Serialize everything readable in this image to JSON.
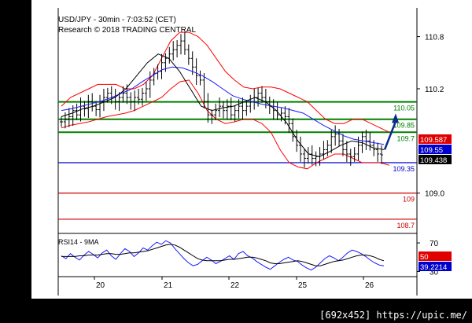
{
  "header": {
    "symbol_line": "USD/JPY - 30min - 7:03:52 (CET)",
    "research_line": "Research © 2018 TRADING CENTRAL"
  },
  "watermark": "[692x452] https://upic.me/",
  "colors": {
    "background": "#ffffff",
    "price_bars": "#000000",
    "bollinger": "#ff0000",
    "ma_slow": "#1a1aff",
    "ma_fast": "#000000",
    "resistance": "#008000",
    "support_blue": "#0000cc",
    "support_red": "#cc0000",
    "arrow": "#0b2a8c",
    "rsi_line": "#1a1aff",
    "rsi_ma": "#000000",
    "label_bg_red": "#e00000",
    "label_bg_blue": "#0000cc",
    "label_bg_black": "#000000"
  },
  "chart_data": [
    {
      "type": "candlestick",
      "title": "USD/JPY - 30min",
      "y_axis_ticks": [
        "110.8",
        "110.2",
        "109.0"
      ],
      "ylim": [
        108.6,
        110.95
      ],
      "x_axis_ticks": [
        "20",
        "21",
        "22",
        "25",
        "26"
      ],
      "indicators": [
        "Bollinger Bands",
        "Moving Average (slow)",
        "Moving Average (fast)"
      ],
      "levels": [
        {
          "value": 110.05,
          "label": "110.05",
          "color": "green",
          "role": "resistance"
        },
        {
          "value": 109.85,
          "label": "109.85",
          "color": "green",
          "role": "resistance"
        },
        {
          "value": 109.7,
          "label": "109.7",
          "color": "green",
          "role": "pivot"
        },
        {
          "value": 109.35,
          "label": "109.35",
          "color": "blue",
          "role": "support"
        },
        {
          "value": 109.0,
          "label": "109",
          "color": "red",
          "role": "support"
        },
        {
          "value": 108.7,
          "label": "108.7",
          "color": "red",
          "role": "support"
        }
      ],
      "price_labels": [
        {
          "value": 109.587,
          "label": "109.587",
          "bg": "red"
        },
        {
          "value": 109.55,
          "label": "109.55",
          "bg": "blue"
        },
        {
          "value": 109.438,
          "label": "109.438",
          "bg": "black"
        }
      ],
      "close_path": [
        109.82,
        109.85,
        109.88,
        109.95,
        109.9,
        110.0,
        109.97,
        110.05,
        110.0,
        109.96,
        110.05,
        110.1,
        110.15,
        110.1,
        110.05,
        110.1,
        110.15,
        110.1,
        110.05,
        110.1,
        110.08,
        110.15,
        110.2,
        110.3,
        110.38,
        110.4,
        110.5,
        110.55,
        110.6,
        110.65,
        110.7,
        110.75,
        110.65,
        110.55,
        110.45,
        110.35,
        110.3,
        110.05,
        109.9,
        109.9,
        109.95,
        110.0,
        109.95,
        110.0,
        109.9,
        109.95,
        110.0,
        109.95,
        110.0,
        110.05,
        110.1,
        110.15,
        110.1,
        110.05,
        110.0,
        109.95,
        109.9,
        109.92,
        109.88,
        109.8,
        109.65,
        109.55,
        109.45,
        109.4,
        109.45,
        109.4,
        109.42,
        109.45,
        109.5,
        109.55,
        109.65,
        109.68,
        109.6,
        109.5,
        109.45,
        109.42,
        109.45,
        109.55,
        109.65,
        109.6,
        109.55,
        109.5,
        109.45,
        109.44
      ],
      "bb_upper": [
        110.0,
        110.1,
        110.15,
        110.2,
        110.25,
        110.25,
        110.25,
        110.2,
        110.2,
        110.25,
        110.35,
        110.55,
        110.75,
        110.85,
        110.85,
        110.8,
        110.7,
        110.55,
        110.4,
        110.3,
        110.22,
        110.2,
        110.22,
        110.22,
        110.2,
        110.15,
        110.1,
        110.05,
        109.95,
        109.85,
        109.8,
        109.8,
        109.85,
        109.85,
        109.8,
        109.75,
        109.7
      ],
      "bb_lower": [
        109.75,
        109.78,
        109.8,
        109.82,
        109.85,
        109.88,
        109.9,
        109.92,
        109.95,
        110.0,
        110.05,
        110.1,
        110.2,
        110.28,
        110.3,
        110.15,
        109.95,
        109.85,
        109.8,
        109.82,
        109.85,
        109.85,
        109.8,
        109.7,
        109.5,
        109.35,
        109.3,
        109.28,
        109.35,
        109.4,
        109.45,
        109.45,
        109.4,
        109.35,
        109.35,
        109.35,
        109.32
      ],
      "ma_slow": [
        109.95,
        109.97,
        110.0,
        110.03,
        110.06,
        110.1,
        110.15,
        110.2,
        110.28,
        110.35,
        110.42,
        110.45,
        110.44,
        110.4,
        110.35,
        110.28,
        110.2,
        110.12,
        110.08,
        110.05,
        110.02,
        110.0,
        109.98,
        109.95,
        109.92,
        109.85,
        109.78,
        109.72,
        109.66,
        109.62,
        109.6,
        109.58,
        109.56
      ],
      "ma_fast": [
        109.88,
        109.92,
        109.97,
        110.0,
        110.05,
        110.1,
        110.2,
        110.35,
        110.5,
        110.6,
        110.55,
        110.4,
        110.2,
        110.0,
        109.95,
        109.98,
        110.0,
        110.05,
        110.1,
        110.05,
        109.95,
        109.8,
        109.6,
        109.45,
        109.42,
        109.48,
        109.55,
        109.6,
        109.58,
        109.52,
        109.5
      ]
    },
    {
      "type": "line",
      "title": "RSI14 - 9MA",
      "y_axis_ticks": [
        "70",
        "30"
      ],
      "ylim": [
        25,
        80
      ],
      "indicator_labels": [
        {
          "value": 50,
          "label": "50",
          "bg": "red"
        },
        {
          "value": 39.2214,
          "label": "39.2214",
          "bg": "blue"
        }
      ],
      "series": [
        {
          "values": [
            52,
            48,
            55,
            50,
            46,
            53,
            58,
            54,
            49,
            56,
            60,
            52,
            47,
            55,
            62,
            58,
            51,
            56,
            63,
            60,
            66,
            71,
            68,
            73,
            70,
            62,
            55,
            48,
            42,
            38,
            40,
            45,
            50,
            46,
            41,
            44,
            48,
            52,
            47,
            55,
            58,
            52,
            49,
            44,
            40,
            36,
            33,
            38,
            43,
            47,
            50,
            46,
            44,
            39,
            35,
            32,
            36,
            42,
            48,
            52,
            49,
            45,
            50,
            56,
            60,
            58,
            55,
            51,
            46,
            42,
            39,
            38
          ]
        },
        {
          "values": [
            51,
            51,
            51,
            51,
            52,
            52,
            53,
            53,
            53,
            54,
            55,
            55,
            54,
            54,
            55,
            56,
            56,
            57,
            58,
            59,
            61,
            63,
            65,
            67,
            68,
            67,
            64,
            60,
            56,
            52,
            48,
            46,
            45,
            45,
            45,
            45,
            46,
            47,
            47,
            48,
            49,
            50,
            50,
            49,
            47,
            45,
            42,
            41,
            41,
            42,
            43,
            44,
            45,
            44,
            42,
            40,
            38,
            38,
            40,
            42,
            44,
            45,
            46,
            48,
            50,
            52,
            53,
            53,
            52,
            50,
            47,
            45
          ]
        }
      ]
    }
  ]
}
